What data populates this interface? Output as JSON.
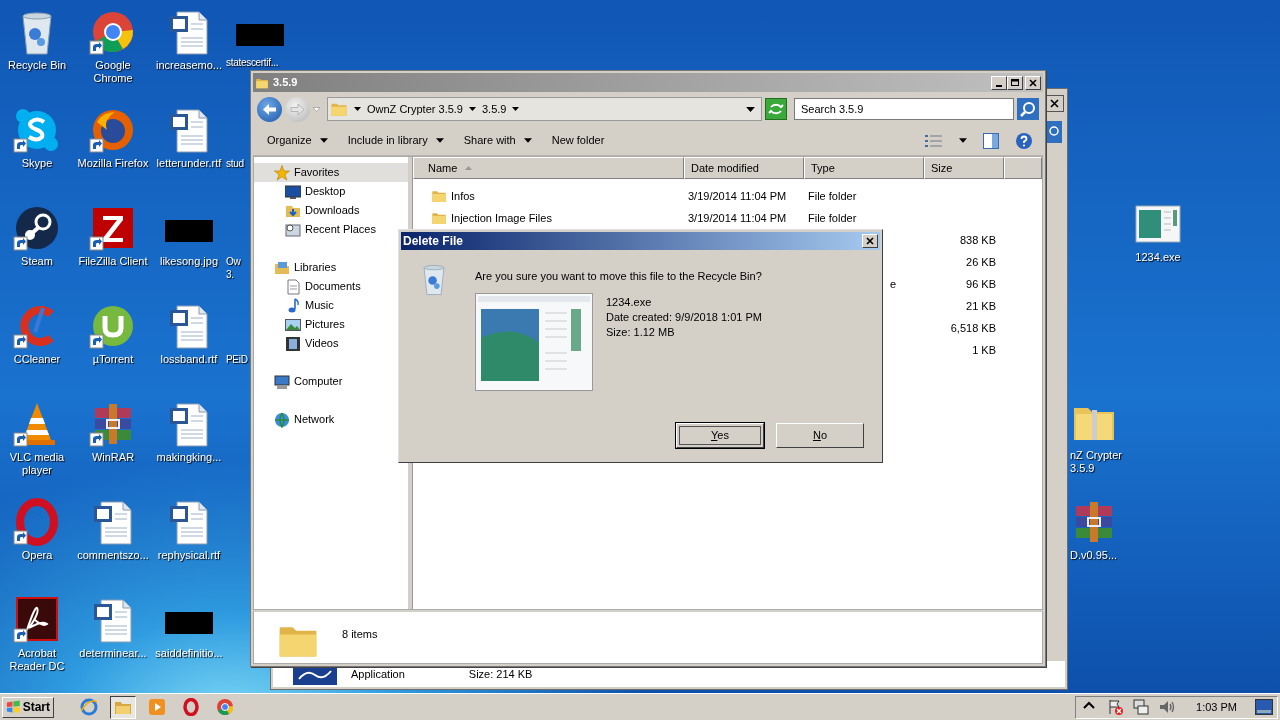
{
  "desktop": {
    "columns": [
      [
        {
          "label": "Recycle Bin",
          "kind": "recycle",
          "shortcut": false
        },
        {
          "label": "Skype",
          "kind": "skype",
          "shortcut": true
        },
        {
          "label": "Steam",
          "kind": "steam",
          "shortcut": true
        },
        {
          "label": "CCleaner",
          "kind": "ccleaner",
          "shortcut": true
        },
        {
          "label": "VLC media player",
          "kind": "vlc",
          "shortcut": true
        },
        {
          "label": "Opera",
          "kind": "opera",
          "shortcut": true
        },
        {
          "label": "Acrobat Reader DC",
          "kind": "acrobat",
          "shortcut": true
        }
      ],
      [
        {
          "label": "Google Chrome",
          "kind": "chrome",
          "shortcut": true
        },
        {
          "label": "Mozilla Firefox",
          "kind": "firefox",
          "shortcut": true
        },
        {
          "label": "FileZilla Client",
          "kind": "filezilla",
          "shortcut": true
        },
        {
          "label": "µTorrent",
          "kind": "utorrent",
          "shortcut": true
        },
        {
          "label": "WinRAR",
          "kind": "winrar",
          "shortcut": true
        },
        {
          "label": "commentszo...",
          "kind": "word",
          "shortcut": false
        },
        {
          "label": "determinear...",
          "kind": "word",
          "shortcut": false
        }
      ],
      [
        {
          "label": "increasemo...",
          "kind": "word",
          "shortcut": false
        },
        {
          "label": "letterunder.rtf",
          "kind": "word",
          "shortcut": false
        },
        {
          "label": "likesong.jpg",
          "kind": "redacted",
          "shortcut": false
        },
        {
          "label": "lossband.rtf",
          "kind": "word",
          "shortcut": false
        },
        {
          "label": "makingking...",
          "kind": "word",
          "shortcut": false
        },
        {
          "label": "rephysical.rtf",
          "kind": "word",
          "shortcut": false
        },
        {
          "label": "saiddefinitio...",
          "kind": "redacted",
          "shortcut": false
        }
      ]
    ],
    "partial_column": [
      {
        "label": "statescertif...",
        "kind": "redacted"
      },
      {
        "label": "stud",
        "kind": "covered"
      },
      {
        "label": "Ow 3.",
        "kind": "covered"
      },
      {
        "label": "PEiD",
        "kind": "covered"
      }
    ],
    "right_icons": [
      {
        "label": "1234.exe",
        "kind": "exe"
      },
      {
        "label": "nZ Crypter 3.5.9",
        "kind": "zipfolder"
      },
      {
        "label": "D.v0.95...",
        "kind": "winrar"
      }
    ]
  },
  "back_window": {
    "details": [
      "Application",
      "Size: 214 KB"
    ]
  },
  "explorer": {
    "title": "3.5.9",
    "breadcrumbs": [
      "OwnZ Crypter 3.5.9",
      "3.5.9"
    ],
    "search": {
      "placeholder": "Search 3.5.9"
    },
    "toolbar": [
      {
        "label": "Organize",
        "dropdown": true
      },
      {
        "label": "Include in library",
        "dropdown": true
      },
      {
        "label": "Share with",
        "dropdown": true
      },
      {
        "label": "New folder",
        "dropdown": false
      }
    ],
    "nav": [
      {
        "label": "Favorites",
        "kind": "star",
        "selected": true,
        "children": [
          {
            "label": "Desktop",
            "kind": "desktop",
            "selected": false
          },
          {
            "label": "Downloads",
            "kind": "downloads",
            "selected": false
          },
          {
            "label": "Recent Places",
            "kind": "recent",
            "selected": false
          }
        ]
      },
      {
        "label": "Libraries",
        "kind": "library",
        "selected": false,
        "children": [
          {
            "label": "Documents",
            "kind": "documents",
            "selected": false
          },
          {
            "label": "Music",
            "kind": "music",
            "selected": false
          },
          {
            "label": "Pictures",
            "kind": "pictures",
            "selected": false
          },
          {
            "label": "Videos",
            "kind": "videos",
            "selected": false
          }
        ]
      },
      {
        "label": "Computer",
        "kind": "computer",
        "selected": false
      },
      {
        "label": "Network",
        "kind": "network",
        "selected": false
      }
    ],
    "columns": [
      {
        "label": "Name",
        "sorted": true
      },
      {
        "label": "Date modified",
        "sorted": false
      },
      {
        "label": "Type",
        "sorted": false
      },
      {
        "label": "Size",
        "sorted": false
      }
    ],
    "rows": [
      {
        "kind": "folder",
        "name": "Infos",
        "date": "3/19/2014 11:04 PM",
        "type": "File folder"
      },
      {
        "kind": "folder",
        "name": "Injection Image Files",
        "date": "3/19/2014 11:04 PM",
        "type": "File folder"
      },
      {
        "kind": "covered",
        "size": "838 KB"
      },
      {
        "kind": "covered",
        "size": "26 KB"
      },
      {
        "kind": "covered",
        "type": "e",
        "size": "96 KB"
      },
      {
        "kind": "covered",
        "size": "21 KB"
      },
      {
        "kind": "covered",
        "size": "6,518 KB"
      },
      {
        "kind": "covered",
        "size": "1 KB"
      }
    ],
    "status": "8 items"
  },
  "dialog": {
    "title": "Delete File",
    "question": "Are you sure you want to move this file to the Recycle Bin?",
    "details": [
      "1234.exe",
      "Date created: 9/9/2018 1:01 PM",
      "Size: 1.12 MB"
    ],
    "buttons": [
      {
        "label": "Yes",
        "focused": true
      },
      {
        "label": "No",
        "focused": false
      }
    ]
  },
  "taskbar": {
    "start": "Start",
    "apps": [
      {
        "kind": "ie",
        "active": false
      },
      {
        "kind": "explorer",
        "active": true
      },
      {
        "kind": "media",
        "active": false
      },
      {
        "kind": "opera",
        "active": false
      },
      {
        "kind": "chrome",
        "active": false
      }
    ],
    "tray": [
      {
        "kind": "arrow"
      },
      {
        "kind": "flag"
      },
      {
        "kind": "network"
      },
      {
        "kind": "speaker"
      }
    ],
    "clock": "1:03 PM"
  }
}
